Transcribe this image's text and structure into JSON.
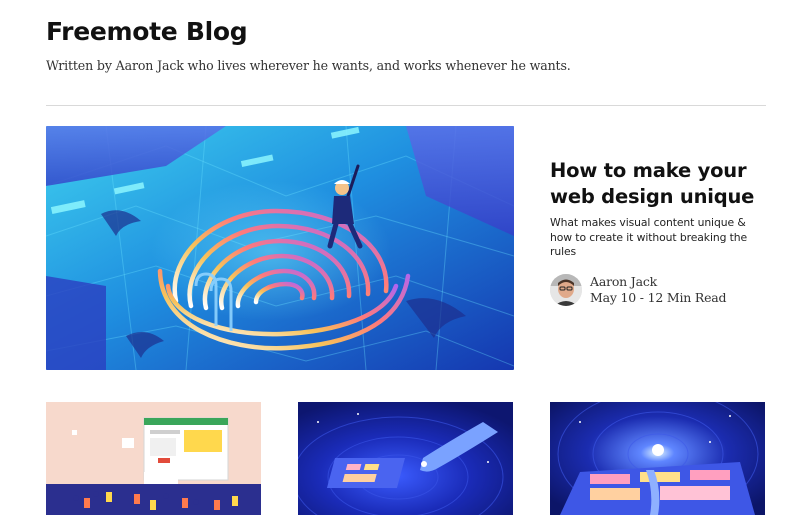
{
  "blog": {
    "title": "Freemote Blog",
    "subtitle": "Written by Aaron Jack who lives wherever he wants, and works whenever he wants."
  },
  "featured": {
    "image_icon": "fingerprint-pool-illustration",
    "title": "How to make your web design unique",
    "excerpt": "What makes visual content unique & how to create it without breaking the rules",
    "author": {
      "name": "Aaron Jack",
      "avatar_icon": "author-avatar"
    },
    "post_info": "May 10 - 12 Min Read"
  },
  "cards": [
    {
      "image_icon": "people-with-browser-window-illustration"
    },
    {
      "image_icon": "hand-touching-screen-illustration"
    },
    {
      "image_icon": "portal-with-dashboard-illustration"
    }
  ]
}
